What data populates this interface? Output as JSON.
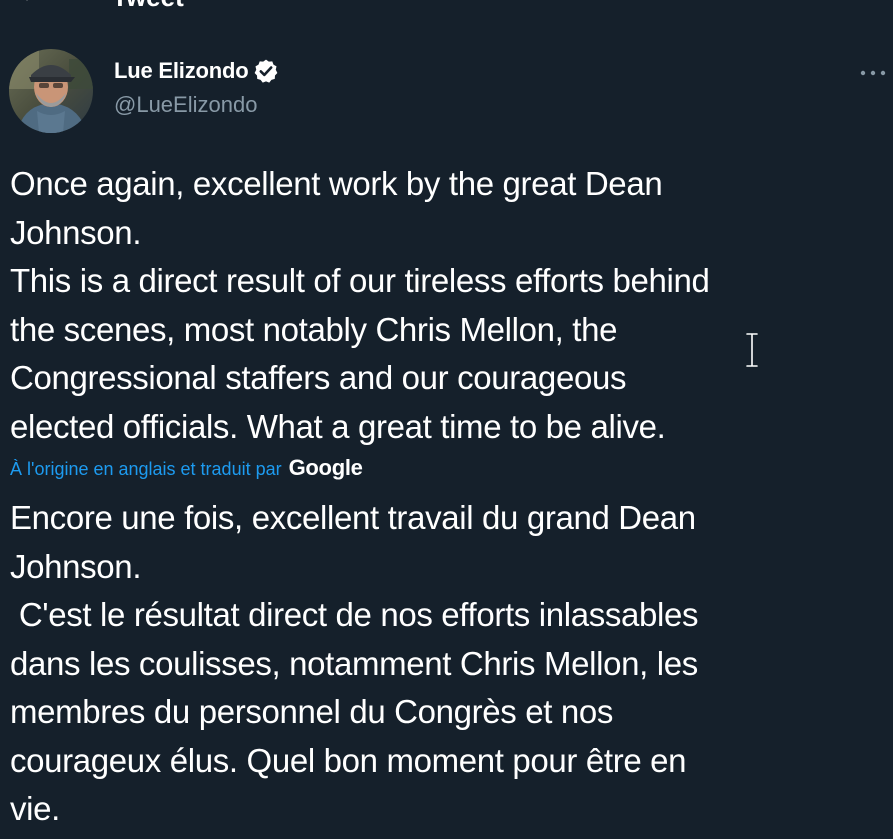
{
  "header": {
    "title": "Tweet",
    "back_icon": "arrow-left-icon"
  },
  "author": {
    "display_name": "Lue Elizondo",
    "handle": "@LueElizondo",
    "verified_icon": "verified-badge-icon",
    "more_icon": "more-horizontal-icon"
  },
  "tweet": {
    "lines": [
      "Once again, excellent work by the great Dean",
      "Johnson.",
      "This is a direct result of our tireless efforts behind",
      "the scenes, most notably Chris Mellon, the",
      "Congressional staffers and our courageous",
      "elected officials. What a great time to be alive."
    ]
  },
  "translation": {
    "label": "À l'origine en anglais et traduit par",
    "provider": "Google",
    "lines": [
      "Encore une fois, excellent travail du grand Dean",
      "Johnson.",
      " C'est le résultat direct de nos efforts inlassables",
      "dans les coulisses, notamment Chris Mellon, les",
      "membres du personnel du Congrès et nos",
      "courageux élus. Quel bon moment pour être en",
      "vie."
    ]
  },
  "colors": {
    "background": "#15202b",
    "text": "#ffffff",
    "secondary_text": "#8899a6",
    "accent": "#1d9bf0"
  }
}
